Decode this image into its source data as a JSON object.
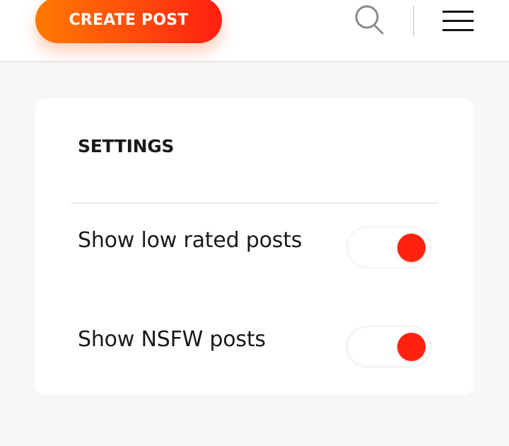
{
  "header": {
    "create_post_label": "CREATE POST",
    "search_icon": "search-icon",
    "menu_icon": "hamburger-menu-icon"
  },
  "settings": {
    "title": "SETTINGS",
    "items": [
      {
        "label": "Show low rated posts",
        "enabled": true
      },
      {
        "label": "Show NSFW posts",
        "enabled": true
      }
    ]
  },
  "colors": {
    "accent_start": "#ff7a00",
    "accent_end": "#ff1e10",
    "toggle_knob": "#ff230f",
    "page_background": "#f7f7f7"
  }
}
